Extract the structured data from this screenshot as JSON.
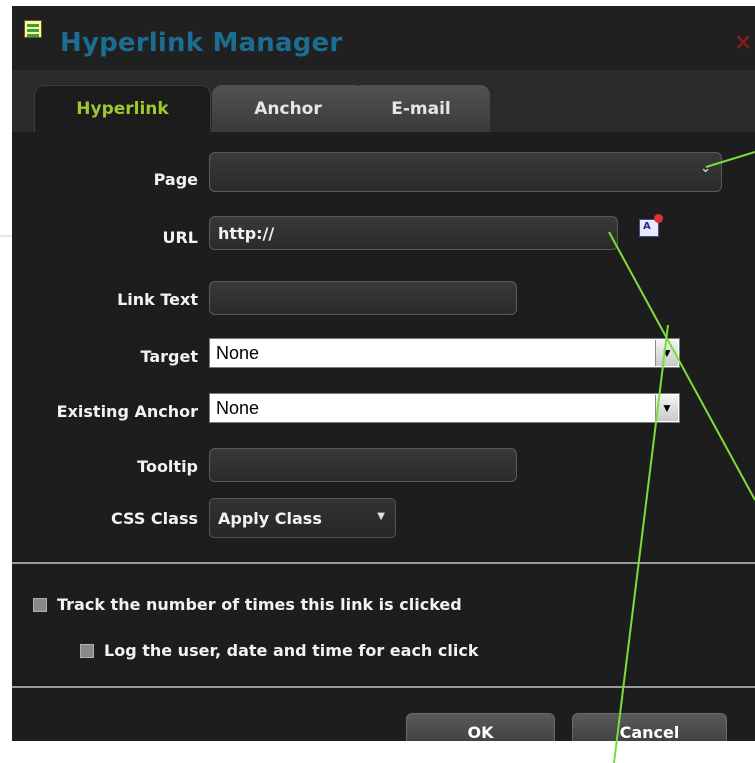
{
  "window": {
    "title": "Hyperlink Manager",
    "close_glyph": "×"
  },
  "tabs": [
    {
      "label": "Hyperlink",
      "active": true
    },
    {
      "label": "Anchor",
      "active": false
    },
    {
      "label": "E-mail",
      "active": false
    }
  ],
  "form": {
    "page": {
      "label": "Page",
      "value": ""
    },
    "url": {
      "label": "URL",
      "value": "http://"
    },
    "link_text": {
      "label": "Link Text",
      "value": ""
    },
    "target": {
      "label": "Target",
      "value": "None"
    },
    "existing_anchor": {
      "label": "Existing Anchor",
      "value": "None"
    },
    "tooltip": {
      "label": "Tooltip",
      "value": ""
    },
    "css_class": {
      "label": "CSS Class",
      "value": "Apply Class"
    }
  },
  "options": {
    "track_clicks": {
      "label": "Track the number of times this link is clicked",
      "checked": false
    },
    "log_user": {
      "label": "Log the user, date and time for each click",
      "checked": false
    }
  },
  "buttons": {
    "ok": "OK",
    "cancel": "Cancel"
  },
  "icons": {
    "title": "document-list-icon",
    "url_browse": "document-browse-icon"
  },
  "colors": {
    "accent_tab": "#9ec82e",
    "title": "#1b6d92",
    "annotation_line": "#7ddc3a"
  }
}
